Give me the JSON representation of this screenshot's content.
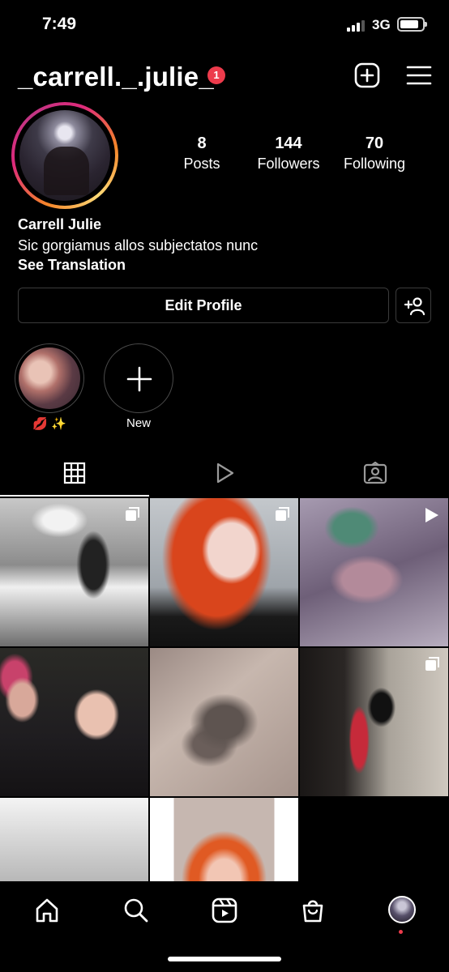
{
  "status_bar": {
    "time": "7:49",
    "network": "3G",
    "signal_bars": 3
  },
  "header": {
    "username": "_carrell._.julie_",
    "notification_count": "1",
    "new_post_icon": "plus-square-icon",
    "menu_icon": "hamburger-menu-icon"
  },
  "profile": {
    "stats": {
      "posts_count": "8",
      "posts_label": "Posts",
      "followers_count": "144",
      "followers_label": "Followers",
      "following_count": "70",
      "following_label": "Following"
    },
    "full_name": "Carrell Julie",
    "bio": "Sic gorgiamus allos subjectatos nunc",
    "see_translation": "See Translation",
    "edit_profile_label": "Edit Profile",
    "add_friend_icon": "add-person-icon"
  },
  "highlights": [
    {
      "label": "💋 ✨"
    },
    {
      "label": "New"
    }
  ],
  "tabs": [
    {
      "icon": "grid-icon",
      "selected": true
    },
    {
      "icon": "reels-play-icon",
      "selected": false
    },
    {
      "icon": "tagged-person-icon",
      "selected": false
    }
  ],
  "posts": [
    {
      "type": "carousel"
    },
    {
      "type": "carousel"
    },
    {
      "type": "reel"
    },
    {
      "type": "photo"
    },
    {
      "type": "photo"
    },
    {
      "type": "carousel"
    },
    {
      "type": "photo"
    },
    {
      "type": "photo"
    }
  ],
  "bottom_nav": [
    {
      "icon": "home-icon"
    },
    {
      "icon": "search-icon"
    },
    {
      "icon": "reels-icon"
    },
    {
      "icon": "shop-bag-icon"
    },
    {
      "icon": "profile-avatar-icon",
      "has_notification_dot": true
    }
  ],
  "colors": {
    "background": "#000000",
    "badge": "#ed3b4c",
    "story_ring_start": "#f58529",
    "story_ring_end": "#dd2a7b"
  }
}
